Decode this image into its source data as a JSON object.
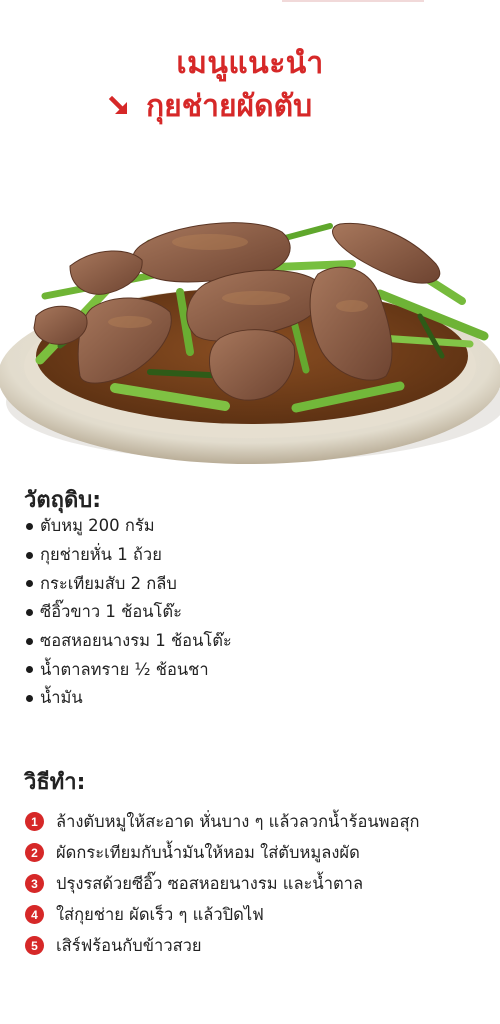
{
  "title": {
    "line1": "เมนูแนะนำ",
    "line2": "กุยช่ายผัดตับ",
    "arrow_icon": "arrow-down-right-icon",
    "accent_color": "#d62828"
  },
  "image": {
    "subject": "stir-fried-liver-with-chives-dish"
  },
  "ingredients": {
    "heading": "วัตถุดิบ:",
    "items": [
      "ตับหมู 200 กรัม",
      "กุยช่ายหั่น 1 ถ้วย",
      "กระเทียมสับ 2 กลีบ",
      "ซีอิ๊วขาว 1 ช้อนโต๊ะ",
      "ซอสหอยนางรม 1 ช้อนโต๊ะ",
      "น้ำตาลทราย ½ ช้อนชา",
      "น้ำมัน"
    ]
  },
  "method": {
    "heading": "วิธีทำ:",
    "steps": [
      {
        "num": "1",
        "text": "ล้างตับหมูให้สะอาด หั่นบาง ๆ แล้วลวกน้ำร้อนพอสุก"
      },
      {
        "num": "2",
        "text": "ผัดกระเทียมกับน้ำมันให้หอม ใส่ตับหมูลงผัด"
      },
      {
        "num": "3",
        "text": "ปรุงรสด้วยซีอิ๊ว ซอสหอยนางรม และน้ำตาล"
      },
      {
        "num": "4",
        "text": "ใส่กุยช่าย ผัดเร็ว ๆ แล้วปิดไฟ"
      },
      {
        "num": "5",
        "text": "เสิร์ฟร้อนกับข้าวสวย"
      }
    ]
  }
}
